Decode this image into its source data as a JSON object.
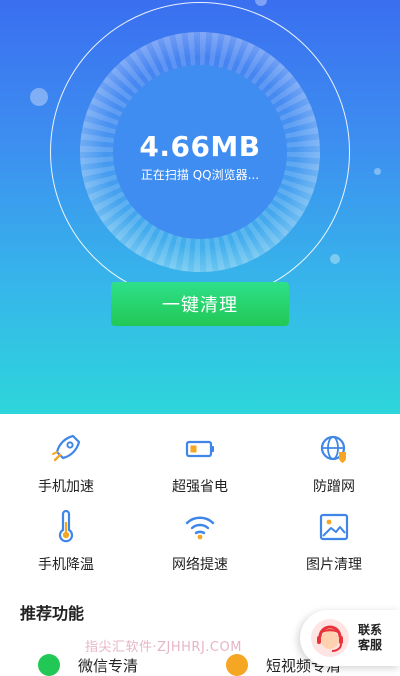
{
  "hero": {
    "size": "4.66MB",
    "status": "正在扫描 QQ浏览器...",
    "clean_button": "一键清理"
  },
  "features": [
    {
      "label": "手机加速",
      "icon": "rocket-icon"
    },
    {
      "label": "超强省电",
      "icon": "battery-icon"
    },
    {
      "label": "防蹭网",
      "icon": "globe-shield-icon"
    },
    {
      "label": "手机降温",
      "icon": "thermometer-icon"
    },
    {
      "label": "网络提速",
      "icon": "wifi-icon"
    },
    {
      "label": "图片清理",
      "icon": "image-icon"
    }
  ],
  "recommend": {
    "title": "推荐功能",
    "items": [
      {
        "label": "微信专清",
        "icon": "wechat-icon"
      },
      {
        "label": "短视频专清",
        "icon": "video-icon"
      }
    ]
  },
  "watermark": "指尖汇软件·ZJHHRJ.COM",
  "service": {
    "line1": "联系",
    "line2": "客服"
  },
  "colors": {
    "accent_blue": "#3a6ff0",
    "accent_teal": "#2dd6da",
    "button_green": "#22c855",
    "icon_blue": "#3f86e8",
    "icon_orange": "#f5a623"
  }
}
